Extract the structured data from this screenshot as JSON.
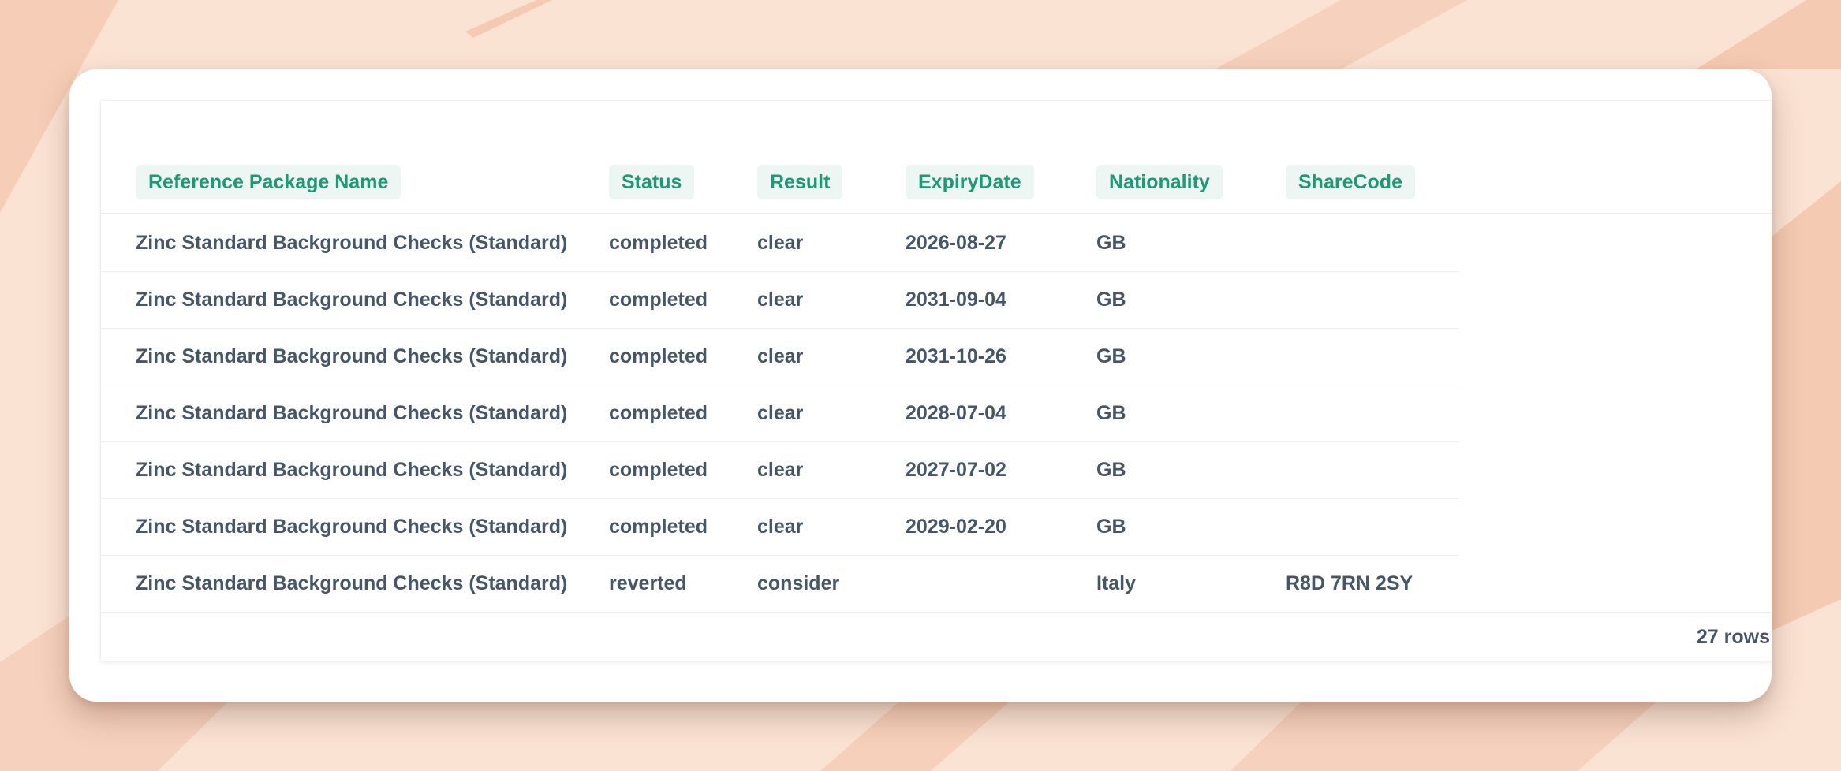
{
  "colors": {
    "background": "#fbe3d4",
    "background_stripe": "#f3c3a9",
    "header_text": "#1a9b77",
    "header_bg": "#eef6f3",
    "cell_text": "#475569"
  },
  "table": {
    "columns": [
      "Reference Package Name",
      "Status",
      "Result",
      "ExpiryDate",
      "Nationality",
      "ShareCode"
    ],
    "rows": [
      [
        "Zinc Standard Background Checks (Standard)",
        "completed",
        "clear",
        "2026-08-27",
        "GB",
        ""
      ],
      [
        "Zinc Standard Background Checks (Standard)",
        "completed",
        "clear",
        "2031-09-04",
        "GB",
        ""
      ],
      [
        "Zinc Standard Background Checks (Standard)",
        "completed",
        "clear",
        "2031-10-26",
        "GB",
        ""
      ],
      [
        "Zinc Standard Background Checks (Standard)",
        "completed",
        "clear",
        "2028-07-04",
        "GB",
        ""
      ],
      [
        "Zinc Standard Background Checks (Standard)",
        "completed",
        "clear",
        "2027-07-02",
        "GB",
        ""
      ],
      [
        "Zinc Standard Background Checks (Standard)",
        "completed",
        "clear",
        "2029-02-20",
        "GB",
        ""
      ],
      [
        "Zinc Standard Background Checks (Standard)",
        "reverted",
        "consider",
        "",
        "Italy",
        "R8D 7RN 2SY"
      ]
    ]
  },
  "footer": {
    "row_count": "27 rows"
  }
}
